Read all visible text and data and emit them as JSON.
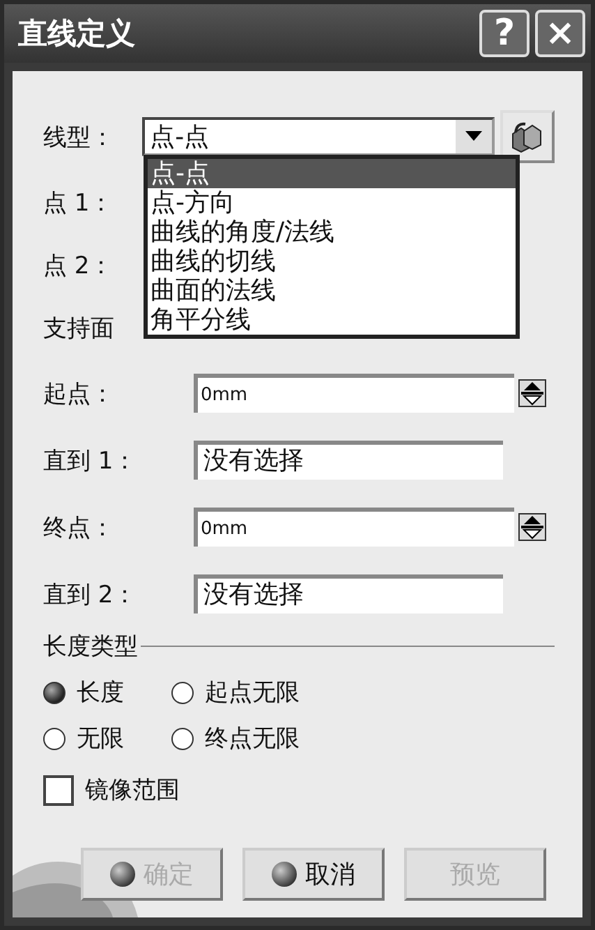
{
  "window": {
    "title": "直线定义",
    "help_button": "?",
    "close_button": "×"
  },
  "line_type": {
    "label": "线型：",
    "value": "点-点",
    "expanded": true,
    "options": [
      {
        "label": "点-点",
        "selected": true
      },
      {
        "label": "点-方向",
        "selected": false
      },
      {
        "label": "曲线的角度/法线",
        "selected": false
      },
      {
        "label": "曲线的切线",
        "selected": false
      },
      {
        "label": "曲面的法线",
        "selected": false
      },
      {
        "label": "角平分线",
        "selected": false
      }
    ]
  },
  "covered_rows": [
    "点 1：",
    "点 2：",
    "支持面"
  ],
  "fields": [
    {
      "label": "起点：",
      "value": "0mm",
      "kind": "spinner"
    },
    {
      "label": "直到 1：",
      "value": "没有选择",
      "kind": "text"
    },
    {
      "label": "终点：",
      "value": "0mm",
      "kind": "spinner"
    },
    {
      "label": "直到 2：",
      "value": "没有选择",
      "kind": "text"
    }
  ],
  "length_type": {
    "title": "长度类型",
    "options": [
      {
        "label": "长度",
        "selected": true
      },
      {
        "label": "起点无限",
        "selected": false
      },
      {
        "label": "无限",
        "selected": false
      },
      {
        "label": "终点无限",
        "selected": false
      }
    ]
  },
  "mirror": {
    "label": "镜像范围",
    "checked": false
  },
  "buttons": [
    {
      "label": "确定",
      "kind": "icon",
      "disabled": true
    },
    {
      "label": "取消",
      "kind": "icon",
      "disabled": false
    },
    {
      "label": "预览",
      "kind": "plain",
      "disabled": true
    }
  ]
}
